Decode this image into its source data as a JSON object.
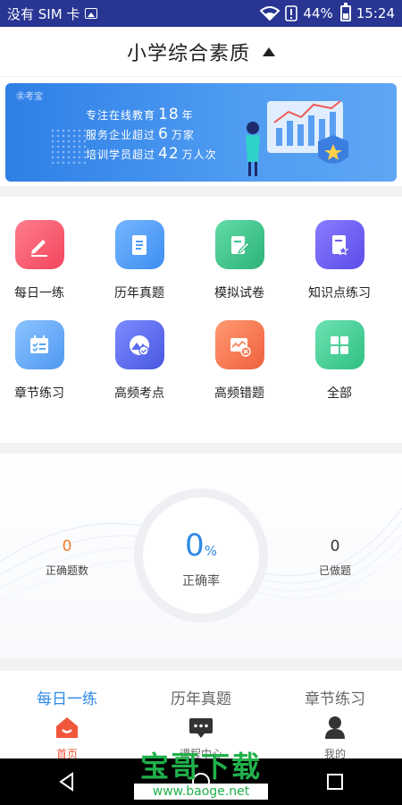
{
  "status_bar": {
    "carrier": "没有 SIM 卡",
    "battery": "44%",
    "time": "15:24"
  },
  "header": {
    "title": "小学综合素质"
  },
  "banner": {
    "tag": "㊎考宝",
    "line1_prefix": "专注在线教育",
    "line1_num": "18",
    "line1_suffix": "年",
    "line2_prefix": "服务企业超过",
    "line2_num": "6",
    "line2_suffix": "万家",
    "line3_prefix": "培训学员超过",
    "line3_num": "42",
    "line3_suffix": "万人次"
  },
  "grid": {
    "items": [
      {
        "label": "每日一练",
        "icon": "pencil-icon",
        "color": "#f4566a"
      },
      {
        "label": "历年真题",
        "icon": "document-icon",
        "color": "#4d9df5"
      },
      {
        "label": "模拟试卷",
        "icon": "edit-paper-icon",
        "color": "#3cc18a"
      },
      {
        "label": "知识点练习",
        "icon": "star-doc-icon",
        "color": "#6b5ef0"
      },
      {
        "label": "章节练习",
        "icon": "checklist-icon",
        "color": "#5aa6f7"
      },
      {
        "label": "高频考点",
        "icon": "mountain-check-icon",
        "color": "#5b6cf0"
      },
      {
        "label": "高频错题",
        "icon": "error-chart-icon",
        "color": "#f97a55"
      },
      {
        "label": "全部",
        "icon": "grid-icon",
        "color": "#3fcf94"
      }
    ]
  },
  "stats": {
    "correct_count": "0",
    "correct_count_label": "正确题数",
    "rate_value": "0",
    "rate_unit": "%",
    "rate_label": "正确率",
    "done_count": "0",
    "done_label": "已做题"
  },
  "tabs": {
    "items": [
      {
        "title": "每日一练",
        "label": "首页",
        "icon": "home-icon",
        "active": true
      },
      {
        "title": "历年真题",
        "label": "课程中心",
        "icon": "chat-icon",
        "active": false
      },
      {
        "title": "章节练习",
        "label": "我的",
        "icon": "user-icon",
        "active": false
      }
    ]
  },
  "watermark": {
    "text": "宝哥下载",
    "url": "www.baoge.net"
  },
  "colors": {
    "accent": "#2e8ae6",
    "status_bar": "#283593",
    "orange": "#f07a2a"
  }
}
